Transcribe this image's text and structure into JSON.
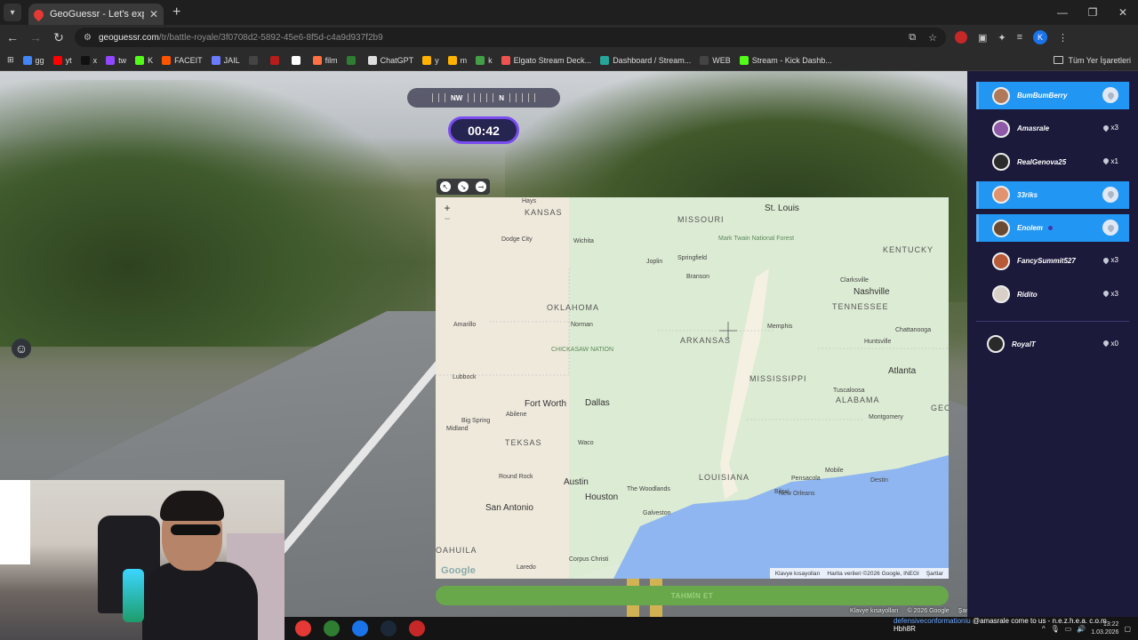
{
  "browser": {
    "tab_title": "GeoGuessr - Let's explore the w",
    "url_host": "geoguessr.com",
    "url_path": "/tr/battle-royale/3f0708d2-5892-45e6-8f5d-c4a9d937f2b9",
    "ext_badge": "2",
    "profile_initial": "K"
  },
  "bookmarks": [
    {
      "label": "gg",
      "color": "#4285f4"
    },
    {
      "label": "yt",
      "color": "#ff0000"
    },
    {
      "label": "x",
      "color": "#111111"
    },
    {
      "label": "tw",
      "color": "#9146ff"
    },
    {
      "label": "K",
      "color": "#53fc18"
    },
    {
      "label": "FACEIT",
      "color": "#ff5500"
    },
    {
      "label": "JAIL",
      "color": "#6b7cff"
    },
    {
      "label": "",
      "color": "#444444"
    },
    {
      "label": "",
      "color": "#b71c1c"
    },
    {
      "label": "",
      "color": "#ffffff"
    },
    {
      "label": "film",
      "color": "#ff7043"
    },
    {
      "label": "",
      "color": "#2e7d32"
    },
    {
      "label": "ChatGPT",
      "color": "#dddddd"
    },
    {
      "label": "y",
      "color": "#ffb300"
    },
    {
      "label": "m",
      "color": "#ffb300"
    },
    {
      "label": "k",
      "color": "#43a047"
    },
    {
      "label": "Elgato Stream Deck...",
      "color": "#ef5350"
    },
    {
      "label": "Dashboard / Stream...",
      "color": "#26a69a"
    },
    {
      "label": "WEB",
      "color": "#444444"
    },
    {
      "label": "Stream - Kick Dashb...",
      "color": "#53fc18"
    }
  ],
  "bookmarks_all": "Tüm Yer İşaretleri",
  "game": {
    "compass": [
      "NW",
      "N"
    ],
    "timer": "00:42",
    "guess_button": "TAHMİN ET",
    "footer": [
      "Klavye kısayolları",
      "© 2026 Google",
      "Şartlar"
    ]
  },
  "map": {
    "labels": [
      {
        "t": "KANSAS",
        "cls": "state"
      },
      {
        "t": "MISSOURI",
        "cls": "state"
      },
      {
        "t": "St. Louis",
        "cls": "city"
      },
      {
        "t": "Hays",
        "cls": "small"
      },
      {
        "t": "Dodge City",
        "cls": "small"
      },
      {
        "t": "Wichita",
        "cls": "small"
      },
      {
        "t": "Joplin",
        "cls": "small"
      },
      {
        "t": "Springfield",
        "cls": "small"
      },
      {
        "t": "Mark Twain National Forest",
        "cls": "park"
      },
      {
        "t": "KENTUCKY",
        "cls": "state"
      },
      {
        "t": "Clarksville",
        "cls": "small"
      },
      {
        "t": "Nashville",
        "cls": "city"
      },
      {
        "t": "Branson",
        "cls": "small"
      },
      {
        "t": "OKLAHOMA",
        "cls": "state"
      },
      {
        "t": "Norman",
        "cls": "small"
      },
      {
        "t": "CHICKASAW NATION",
        "cls": "park"
      },
      {
        "t": "Amarillo",
        "cls": "small"
      },
      {
        "t": "ARKANSAS",
        "cls": "state"
      },
      {
        "t": "Memphis",
        "cls": "small"
      },
      {
        "t": "TENNESSEE",
        "cls": "state"
      },
      {
        "t": "Huntsville",
        "cls": "small"
      },
      {
        "t": "Chattanooga",
        "cls": "small"
      },
      {
        "t": "Lubbock",
        "cls": "small"
      },
      {
        "t": "Atlanta",
        "cls": "city"
      },
      {
        "t": "MISSISSIPPI",
        "cls": "state"
      },
      {
        "t": "Tuscaloosa",
        "cls": "small"
      },
      {
        "t": "ALABAMA",
        "cls": "state"
      },
      {
        "t": "GEO",
        "cls": "state"
      },
      {
        "t": "Fort Worth",
        "cls": "city"
      },
      {
        "t": "Dallas",
        "cls": "city"
      },
      {
        "t": "Big Spring",
        "cls": "small"
      },
      {
        "t": "Abilene",
        "cls": "small"
      },
      {
        "t": "Midland",
        "cls": "small"
      },
      {
        "t": "Montgomery",
        "cls": "small"
      },
      {
        "t": "TEKSAS",
        "cls": "state"
      },
      {
        "t": "Waco",
        "cls": "small"
      },
      {
        "t": "Mobile",
        "cls": "small"
      },
      {
        "t": "Round Rock",
        "cls": "small"
      },
      {
        "t": "Austin",
        "cls": "city"
      },
      {
        "t": "The Woodlands",
        "cls": "small"
      },
      {
        "t": "LOUISIANA",
        "cls": "state"
      },
      {
        "t": "Pensacola",
        "cls": "small"
      },
      {
        "t": "Destin",
        "cls": "small"
      },
      {
        "t": "Biloxi",
        "cls": "small"
      },
      {
        "t": "New Orleans",
        "cls": "small"
      },
      {
        "t": "Houston",
        "cls": "city"
      },
      {
        "t": "Galveston",
        "cls": "small"
      },
      {
        "t": "San Antonio",
        "cls": "city"
      },
      {
        "t": "OAHUILA",
        "cls": "state"
      },
      {
        "t": "Laredo",
        "cls": "small"
      },
      {
        "t": "Corpus Christi",
        "cls": "small"
      }
    ],
    "zoom_in": "+",
    "zoom_out": "−",
    "google": "Google",
    "footer": [
      "Klavye kısayolları",
      "Harita verileri ©2026 Google, INEGI",
      "Şartlar"
    ]
  },
  "players": [
    {
      "name": "BumBumBerry",
      "active": true,
      "lives": "",
      "avatar": "#b07a5a"
    },
    {
      "name": "Amasrale",
      "active": false,
      "lives": "x3",
      "avatar": "#8e5aa8"
    },
    {
      "name": "RealGenova25",
      "active": false,
      "lives": "x1",
      "avatar": "#2b2b2b"
    },
    {
      "name": "33riks",
      "active": true,
      "lives": "",
      "avatar": "#e0936e"
    },
    {
      "name": "Enolem",
      "active": true,
      "lives": "",
      "avatar": "#6b4a34"
    },
    {
      "name": "FancySummit527",
      "active": false,
      "lives": "x3",
      "avatar": "#b85a38"
    },
    {
      "name": "Ridito",
      "active": false,
      "lives": "x3",
      "avatar": "#d8cfc7"
    }
  ],
  "eliminated": {
    "name": "RoyalT",
    "lives": "x0",
    "avatar": "#2a2a2a"
  },
  "taskbar": {
    "ticker_user": "defensiveconformationiu",
    "ticker_msg": "@amasrale come to us - n.e.z.h.e.a. c.o.m",
    "ticker_name": "Hbh8R",
    "time": "13:22",
    "date": "1.03.2026",
    "icons": [
      "#e53935",
      "#2e7d32",
      "#1a73e8",
      "#1b2838",
      "#c62828"
    ]
  }
}
